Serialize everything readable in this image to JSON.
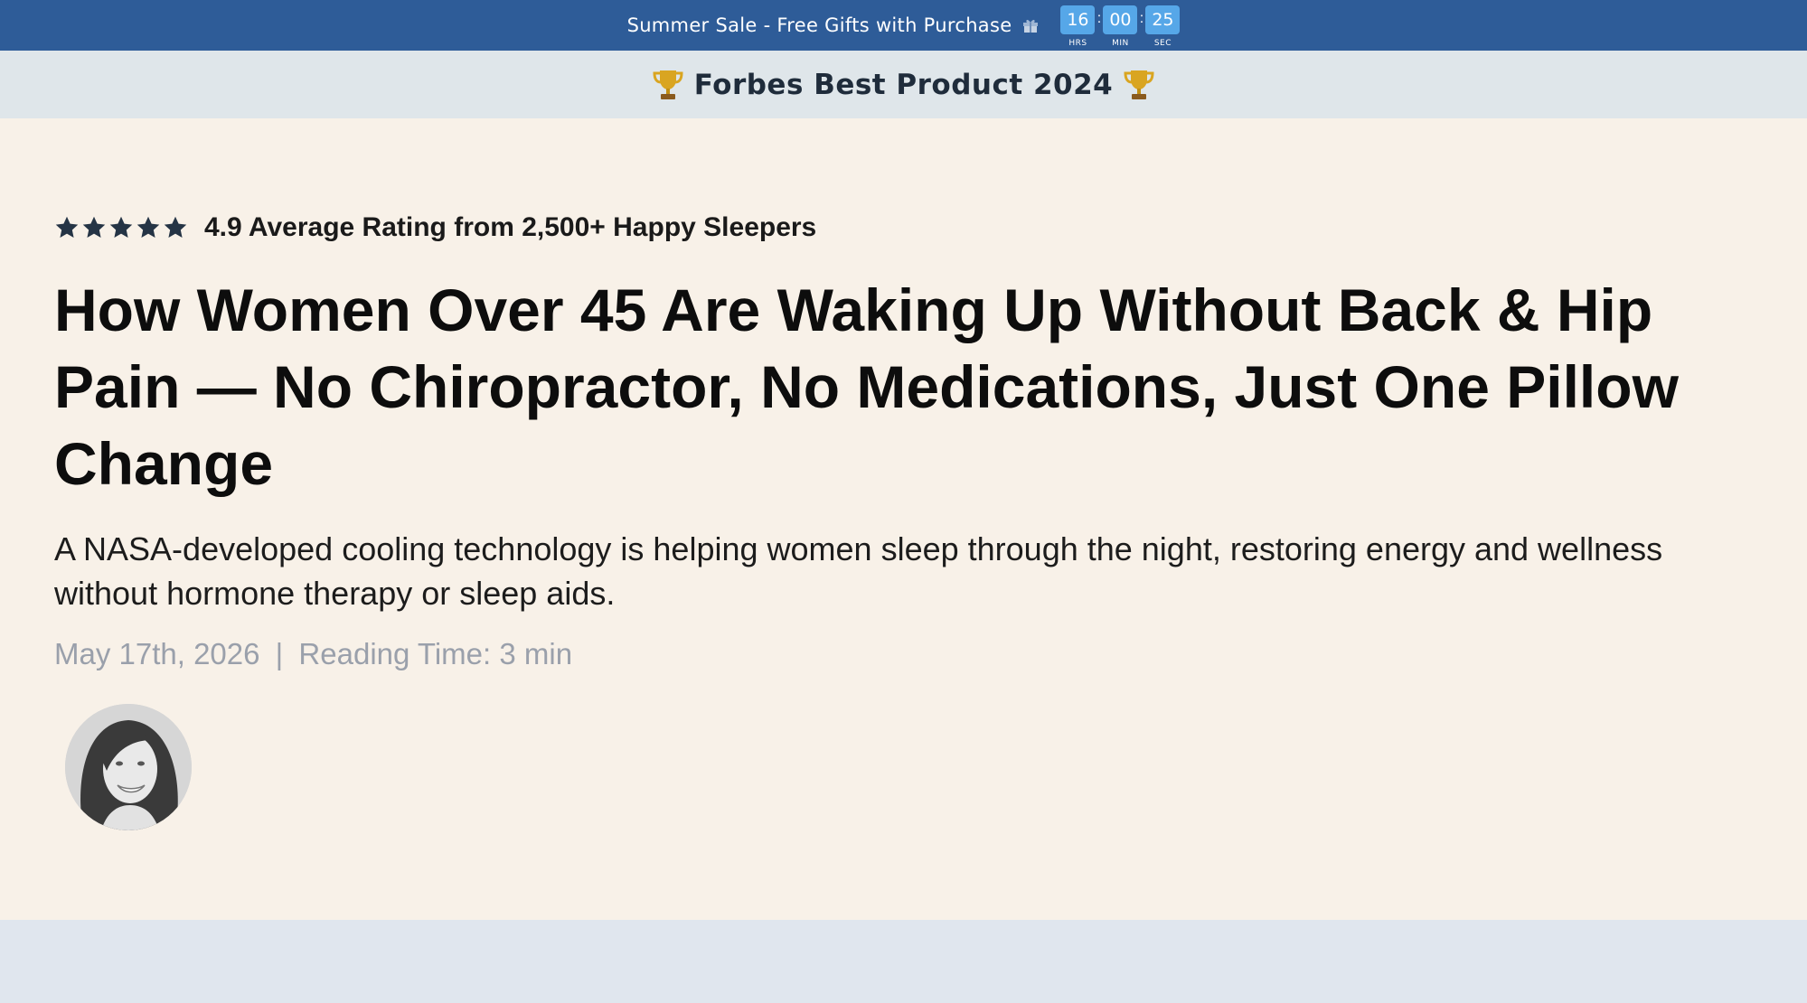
{
  "announcement": {
    "text": "Summer Sale - Free Gifts with Purchase",
    "icon": "gift-icon",
    "countdown": {
      "hours": "16",
      "minutes": "00",
      "seconds": "25",
      "hours_label": "HRS",
      "minutes_label": "MIN",
      "seconds_label": "SEC",
      "separator": ":"
    }
  },
  "award": {
    "text": "Forbes Best Product 2024",
    "icon": "trophy-icon"
  },
  "hero": {
    "rating": {
      "stars": 5,
      "text": "4.9 Average Rating from 2,500+ Happy Sleepers"
    },
    "headline": "How Women Over 45 Are Waking Up Without Back & Hip Pain — No Chiropractor, No Medications, Just One Pillow Change",
    "subheadline": "A NASA-developed cooling technology is helping women sleep through the night, restoring energy and wellness without hormone therapy or sleep aids.",
    "date": "May 17th, 2026",
    "divider": "|",
    "reading_time": "Reading Time: 3 min",
    "author_avatar": "author-photo"
  },
  "colors": {
    "announce_bg": "#2e5c98",
    "countdown_box": "#56a7e8",
    "award_bg": "#dfe6ea",
    "hero_bg": "#f8f1e8",
    "footer_bg": "#e0e6ee",
    "star": "#253445",
    "trophy": "#d9a521"
  }
}
